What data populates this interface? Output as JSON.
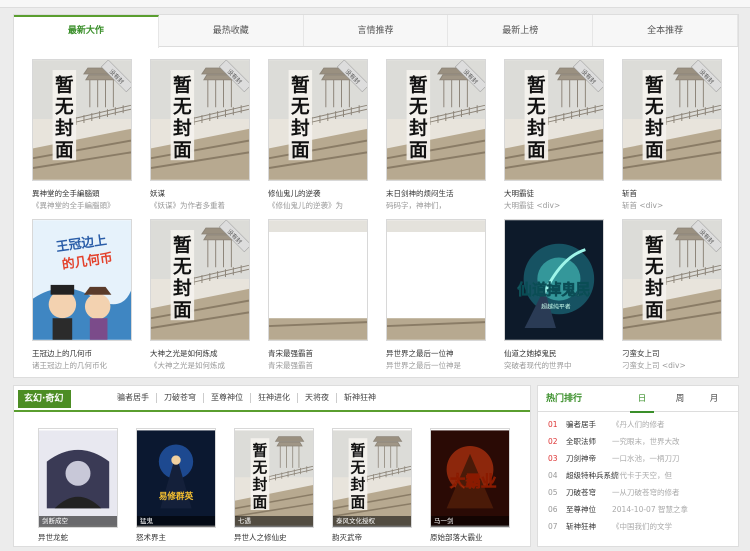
{
  "tabs": [
    "最新大作",
    "最热收藏",
    "言情推荐",
    "最新上榜",
    "全本推荐"
  ],
  "cover_text": {
    "line1": "暂",
    "line2": "无",
    "line3": "封",
    "line4": "面",
    "stamp": "没有封"
  },
  "books_row1": [
    {
      "name": "異神堂的全手編腦頭",
      "desc": "《異神堂的全手編腦頭》"
    },
    {
      "name": "妖谋",
      "desc": "《妖谋》为作者多重着"
    },
    {
      "name": "修仙鬼儿的逆袭",
      "desc": "《修仙鬼儿的逆袭》为"
    },
    {
      "name": "末日剑神的烦闷生活",
      "desc": "码码字，神神们，"
    },
    {
      "name": "大明霸徒",
      "desc": "大明霸徒 <div>"
    },
    {
      "name": "斩首",
      "desc": "斩首 <div>"
    }
  ],
  "books_row2": [
    {
      "name": "王冠边上的几何币",
      "desc": "诸王冠边上的几何币化"
    },
    {
      "name": "大神之光是如何炼成",
      "desc": "《大神之光是如何炼成"
    },
    {
      "name": "青宋最强霸首",
      "desc": "青宋最强霸首"
    },
    {
      "name": "异世界之最后一位神",
      "desc": "异世界之最后一位神是"
    },
    {
      "name": "仙道之她掉鬼民",
      "desc": "突破者现代的世界中"
    },
    {
      "name": "刁蛮女上司",
      "desc": "刁蛮女上司 <div>"
    }
  ],
  "row2_covers": {
    "book1_title": "王冠边上的几何币",
    "book5_title": "仙道掉鬼民",
    "book5_sub": "超越纯平者"
  },
  "section": {
    "title": "玄幻·奇幻",
    "links": [
      "骗者居手",
      "刀破苍穹",
      "至尊神位",
      "狂神进化",
      "天将夜",
      "斩神狂神"
    ],
    "books": [
      {
        "name": "异世龙蛇",
        "desc": "",
        "cap": "剑断成空",
        "art": ""
      },
      {
        "name": "怒术界主",
        "desc": "",
        "cap": "猛鬼",
        "art": "易修群英"
      },
      {
        "name": "异世人之修仙史",
        "desc": "",
        "cap": "七遇",
        "art": ""
      },
      {
        "name": "韵灭武帝",
        "desc": "",
        "cap": "泰风文化授权",
        "art": ""
      },
      {
        "name": "原始部落大霸业",
        "desc": "",
        "cap": "马一剑",
        "art": "大霸业"
      }
    ]
  },
  "ranking": {
    "title": "热门排行",
    "tabs": [
      "日",
      "周",
      "月"
    ],
    "rows": [
      {
        "num": "01",
        "name": "骗者居手",
        "desc": "《丹人们的修者"
      },
      {
        "name": "全职法师",
        "num": "02",
        "desc": "一究眼末，世界大改"
      },
      {
        "num": "03",
        "name": "刀剑神帝",
        "desc": "一口水池，一柄刀刀"
      },
      {
        "num": "04",
        "name": "超级特种兵系统",
        "desc": "时代卡于天空，但"
      },
      {
        "num": "05",
        "name": "刀破苍穹",
        "desc": "一从刀破苍穹的修者"
      },
      {
        "num": "06",
        "name": "至尊神位",
        "desc": "2014-10-07 智慧之拿"
      },
      {
        "num": "07",
        "name": "斩神狂神",
        "desc": "《中国我们的文学"
      }
    ]
  }
}
